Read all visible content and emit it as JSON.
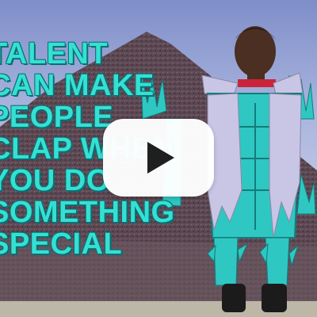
{
  "video": {
    "caption_lines": [
      "TALENT",
      "CAN MAKE",
      "PEOPLE",
      "CLAP WHEN",
      "YOU DO",
      "SOMETHING",
      "SPECIAL"
    ]
  },
  "icons": {
    "play": "play-icon"
  },
  "colors": {
    "caption_text": "#35e0d2",
    "caption_outline": "#0a6f74",
    "costume_teal": "#2fc7c2",
    "costume_silver": "#c9c5e4",
    "play_button_bg": "#ffffff",
    "play_triangle": "#1f1f1f"
  }
}
